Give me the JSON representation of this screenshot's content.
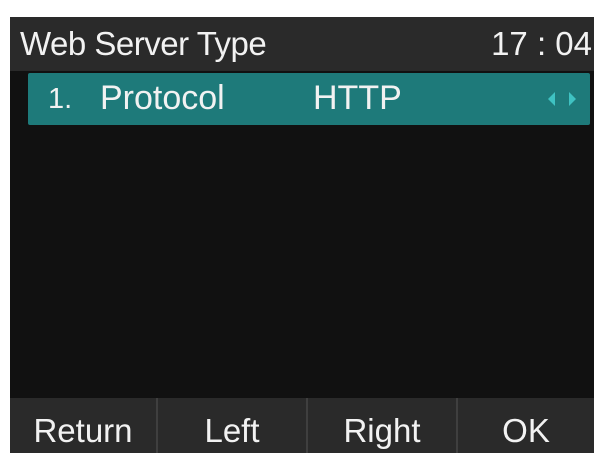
{
  "header": {
    "title": "Web Server Type",
    "time": "17 : 04"
  },
  "menu": {
    "items": [
      {
        "index": "1.",
        "label": "Protocol",
        "value": "HTTP",
        "selected": true,
        "icon": "left-right-arrows-icon"
      }
    ]
  },
  "softkeys": [
    {
      "label": "Return"
    },
    {
      "label": "Left"
    },
    {
      "label": "Right"
    },
    {
      "label": "OK"
    }
  ],
  "colors": {
    "screen_background": "#111111",
    "bar_background": "#2a2a2a",
    "selection_highlight": "#1e7a7a",
    "arrow_color": "#3fc2c2",
    "text": "#f2f2f2"
  }
}
